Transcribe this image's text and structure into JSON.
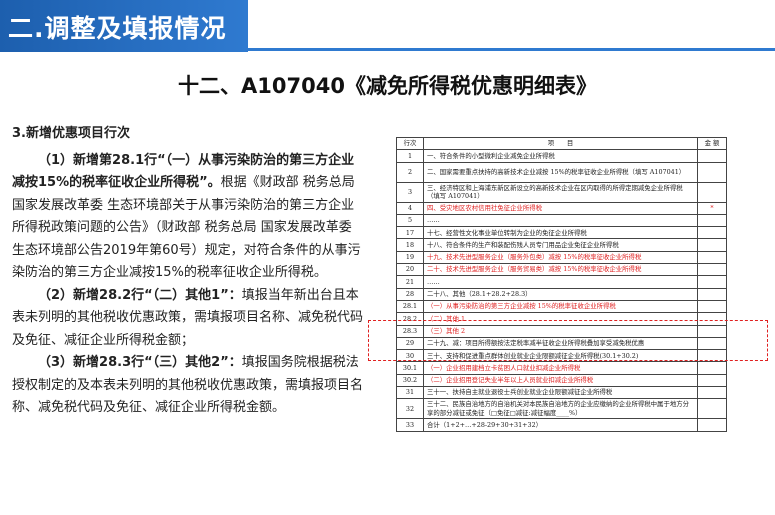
{
  "header": {
    "title": "二.调整及填报情况"
  },
  "main_title": "十二、A107040《减免所得税优惠明细表》",
  "left": {
    "heading": "3.新增优惠项目行次",
    "p1_bold": "（1）新增第28.1行“（一）从事污染防治的第三方企业减按15%的税率征收企业所得税”。",
    "p1_rest": "根据《财政部 税务总局 国家发展改革委 生态环境部关于从事污染防治的第三方企业所得税政策问题的公告》（财政部 税务总局 国家发展改革委 生态环境部公告2019年第60号）规定，对符合条件的从事污染防治的第三方企业减按15%的税率征收企业所得税。",
    "p2_bold": "（2）新增28.2行“（二）其他1”：",
    "p2_rest": "填报当年新出台且本表未列明的其他税收优惠政策，需填报项目名称、减免税代码及免征、减征企业所得税金额；",
    "p3_bold": "（3）新增28.3行“（三）其他2”：",
    "p3_rest": "填报国务院根据税法授权制定的及本表未列明的其他税收优惠政策，需填报项目名称、减免税代码及免征、减征企业所得税金额。"
  },
  "table": {
    "headers": [
      "行次",
      "项　　目",
      "金 额"
    ],
    "rows": [
      {
        "no": "1",
        "item": "一、符合条件的小型微利企业减免企业所得税",
        "amount": "",
        "red": false
      },
      {
        "no": "2",
        "item": "二、国家需要重点扶持的高新技术企业减按 15%的税率征收企业所得税（填写 A107041）",
        "amount": "",
        "red": false
      },
      {
        "no": "3",
        "item": "三、经济特区和上海浦东新区新设立的高新技术企业在区内取得的所得定期减免企业所得税（填写 A107041）",
        "amount": "",
        "red": false
      },
      {
        "no": "4",
        "item": "四、受灾地区农村信用社免征企业所得税",
        "amount": "*",
        "red": true
      },
      {
        "no": "5",
        "item": "……",
        "amount": "",
        "red": false
      },
      {
        "no": "17",
        "item": "十七、经营性文化事业单位转制为企业的免征企业所得税",
        "amount": "",
        "red": false
      },
      {
        "no": "18",
        "item": "十八、符合条件的生产和装配伤残人员专门用品企业免征企业所得税",
        "amount": "",
        "red": false
      },
      {
        "no": "19",
        "item": "十九、技术先进型服务企业（服务外包类）减按 15%的税率征收企业所得税",
        "amount": "",
        "red": true
      },
      {
        "no": "20",
        "item": "二十、技术先进型服务企业（服务贸易类）减按 15%的税率征收企业所得税",
        "amount": "",
        "red": true
      },
      {
        "no": "21",
        "item": "……",
        "amount": "",
        "red": false
      },
      {
        "no": "28",
        "item": "二十八、其他（28.1+28.2+28.3）",
        "amount": "",
        "red": false
      },
      {
        "no": "28.1",
        "item": "（一）从事污染防治的第三方企业减按 15%的税率征收企业所得税",
        "amount": "",
        "red": true
      },
      {
        "no": "28.2",
        "item": "（二）其他 1",
        "amount": "",
        "red": true
      },
      {
        "no": "28.3",
        "item": "（三）其他 2",
        "amount": "",
        "red": true
      },
      {
        "no": "29",
        "item": "二十九、减：项目所得额按法定税率减半征收企业所得税叠加享受减免税优惠",
        "amount": "",
        "red": false
      },
      {
        "no": "30",
        "item": "三十、支持和促进重点群体创业就业企业限额减征企业所得税(30.1+30.2)",
        "amount": "",
        "red": false
      },
      {
        "no": "30.1",
        "item": "（一）企业招用建档立卡贫困人口就业扣减企业所得税",
        "amount": "",
        "red": true
      },
      {
        "no": "30.2",
        "item": "（二）企业招用登记失业半年以上人员就业扣减企业所得税",
        "amount": "",
        "red": true
      },
      {
        "no": "31",
        "item": "三十一、扶持自主就业退役士兵创业就业企业限额减征企业所得税",
        "amount": "",
        "red": false
      },
      {
        "no": "32",
        "item": "三十二、民族自治地方的自治机关对本民族自治地方的企业应缴纳的企业所得税中属于地方分享的部分减征或免征（□免征□减征:减征幅度____%）",
        "amount": "",
        "red": false
      },
      {
        "no": "33",
        "item": "合计（1+2+…+28-29+30+31+32）",
        "amount": "",
        "red": false
      }
    ]
  }
}
